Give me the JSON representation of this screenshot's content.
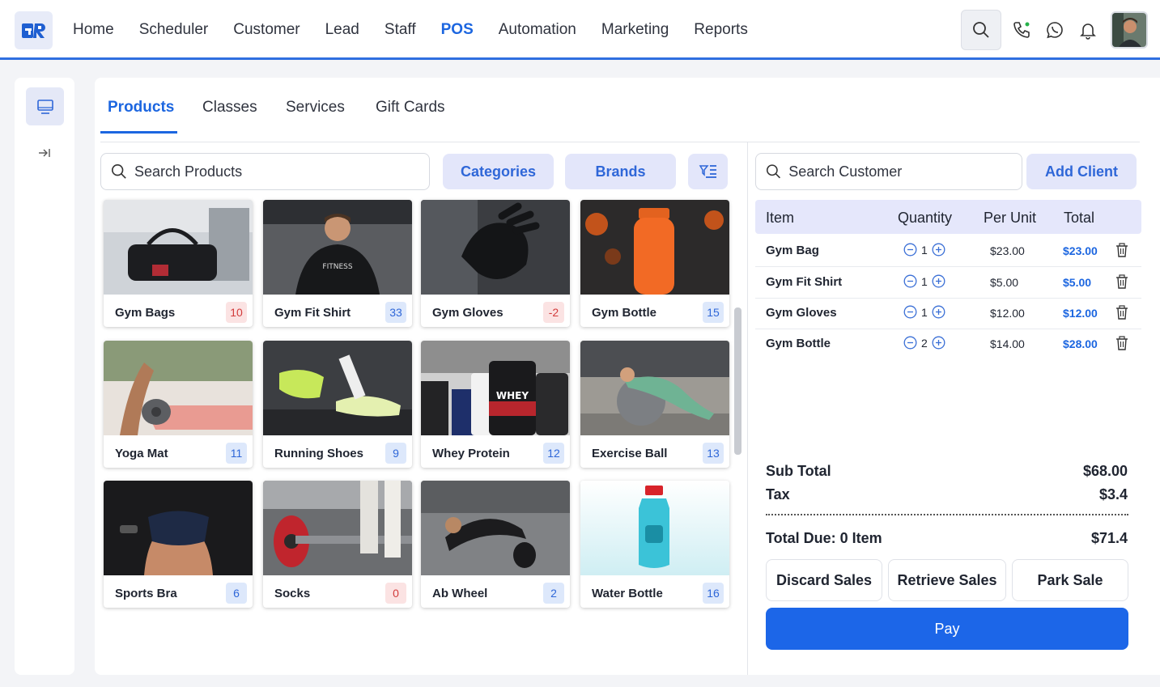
{
  "logo": {
    "text": "GR"
  },
  "nav": {
    "items": [
      "Home",
      "Scheduler",
      "Customer",
      "Lead",
      "Staff",
      "POS",
      "Automation",
      "Marketing",
      "Reports"
    ],
    "active": "POS"
  },
  "tabs": [
    "Products",
    "Classes",
    "Services",
    "Gift Cards"
  ],
  "product_search": {
    "placeholder": "Search Products"
  },
  "filters": {
    "categories": "Categories",
    "brands": "Brands"
  },
  "products": [
    {
      "name": "Gym Bags",
      "stock": "10",
      "tone": "red"
    },
    {
      "name": "Gym Fit Shirt",
      "stock": "33",
      "tone": "blue"
    },
    {
      "name": "Gym Gloves",
      "stock": "-2",
      "tone": "red"
    },
    {
      "name": "Gym Bottle",
      "stock": "15",
      "tone": "blue"
    },
    {
      "name": "Yoga Mat",
      "stock": "11",
      "tone": "blue"
    },
    {
      "name": "Running Shoes",
      "stock": "9",
      "tone": "blue"
    },
    {
      "name": "Whey Protein",
      "stock": "12",
      "tone": "blue"
    },
    {
      "name": "Exercise Ball",
      "stock": "13",
      "tone": "blue"
    },
    {
      "name": "Sports Bra",
      "stock": "6",
      "tone": "blue"
    },
    {
      "name": "Socks",
      "stock": "0",
      "tone": "red"
    },
    {
      "name": "Ab Wheel",
      "stock": "2",
      "tone": "blue"
    },
    {
      "name": "Water Bottle",
      "stock": "16",
      "tone": "blue"
    }
  ],
  "customer_search": {
    "placeholder": "Search Customer"
  },
  "add_client": "Add Client",
  "cart": {
    "headers": {
      "item": "Item",
      "quantity": "Quantity",
      "per_unit": "Per Unit",
      "total": "Total"
    },
    "rows": [
      {
        "item": "Gym Bag",
        "qty": "1",
        "unit": "$23.00",
        "total": "$23.00"
      },
      {
        "item": "Gym Fit Shirt",
        "qty": "1",
        "unit": "$5.00",
        "total": "$5.00"
      },
      {
        "item": "Gym Gloves",
        "qty": "1",
        "unit": "$12.00",
        "total": "$12.00"
      },
      {
        "item": "Gym Bottle",
        "qty": "2",
        "unit": "$14.00",
        "total": "$28.00"
      }
    ]
  },
  "summary": {
    "subtotal_label": "Sub Total",
    "subtotal": "$68.00",
    "tax_label": "Tax",
    "tax": "$3.4",
    "due_label": "Total Due: 0 Item",
    "due": "$71.4"
  },
  "actions": {
    "discard": "Discard Sales",
    "retrieve": "Retrieve Sales",
    "park": "Park Sale",
    "pay": "Pay"
  },
  "colors": {
    "accent": "#1c66e0",
    "pill_bg": "#e3e6fa",
    "pay": "#1c66e8"
  }
}
